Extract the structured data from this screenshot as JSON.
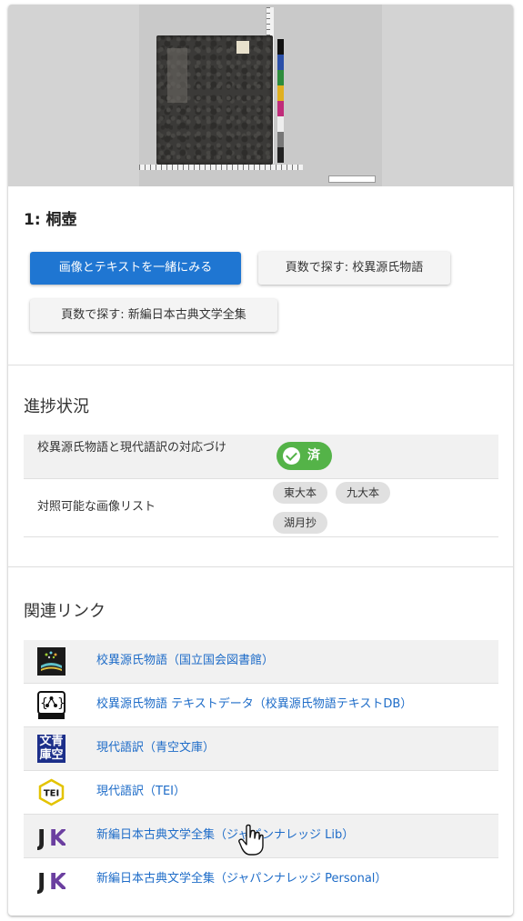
{
  "item": {
    "title": "1: 桐壺"
  },
  "buttons": {
    "view_together": "画像とテキストを一緒にみる",
    "search_kouhon": "頁数で探す: 校異源氏物語",
    "search_shinpen": "頁数で探す: 新編日本古典文学全集"
  },
  "progress": {
    "heading": "進捗状況",
    "rows": [
      {
        "label": "校異源氏物語と現代語訳の対応づけ",
        "status": "済"
      },
      {
        "label": "対照可能な画像リスト",
        "chips": [
          "東大本",
          "九大本",
          "湖月抄"
        ]
      }
    ]
  },
  "links": {
    "heading": "関連リンク",
    "items": [
      {
        "label": "校異源氏物語（国立国会図書館）",
        "icon": "ndl-logo-icon"
      },
      {
        "label": "校異源氏物語 テキストデータ（校異源氏物語テキストDB）",
        "icon": "json-ld-icon"
      },
      {
        "label": "現代語訳（青空文庫）",
        "icon": "aozora-bunko-icon",
        "icon_text": "文青庫空"
      },
      {
        "label": "現代語訳（TEI）",
        "icon": "tei-icon",
        "icon_text": "TEI"
      },
      {
        "label": "新編日本古典文学全集（ジャパンナレッジ Lib）",
        "icon": "japanknowledge-icon",
        "icon_text": "JK"
      },
      {
        "label": "新編日本古典文学全集（ジャパンナレッジ Personal）",
        "icon": "japanknowledge-icon",
        "icon_text": "JK"
      }
    ]
  },
  "colors": {
    "primary": "#1f76d2",
    "success": "#54b348",
    "link": "#1e6cc8"
  }
}
